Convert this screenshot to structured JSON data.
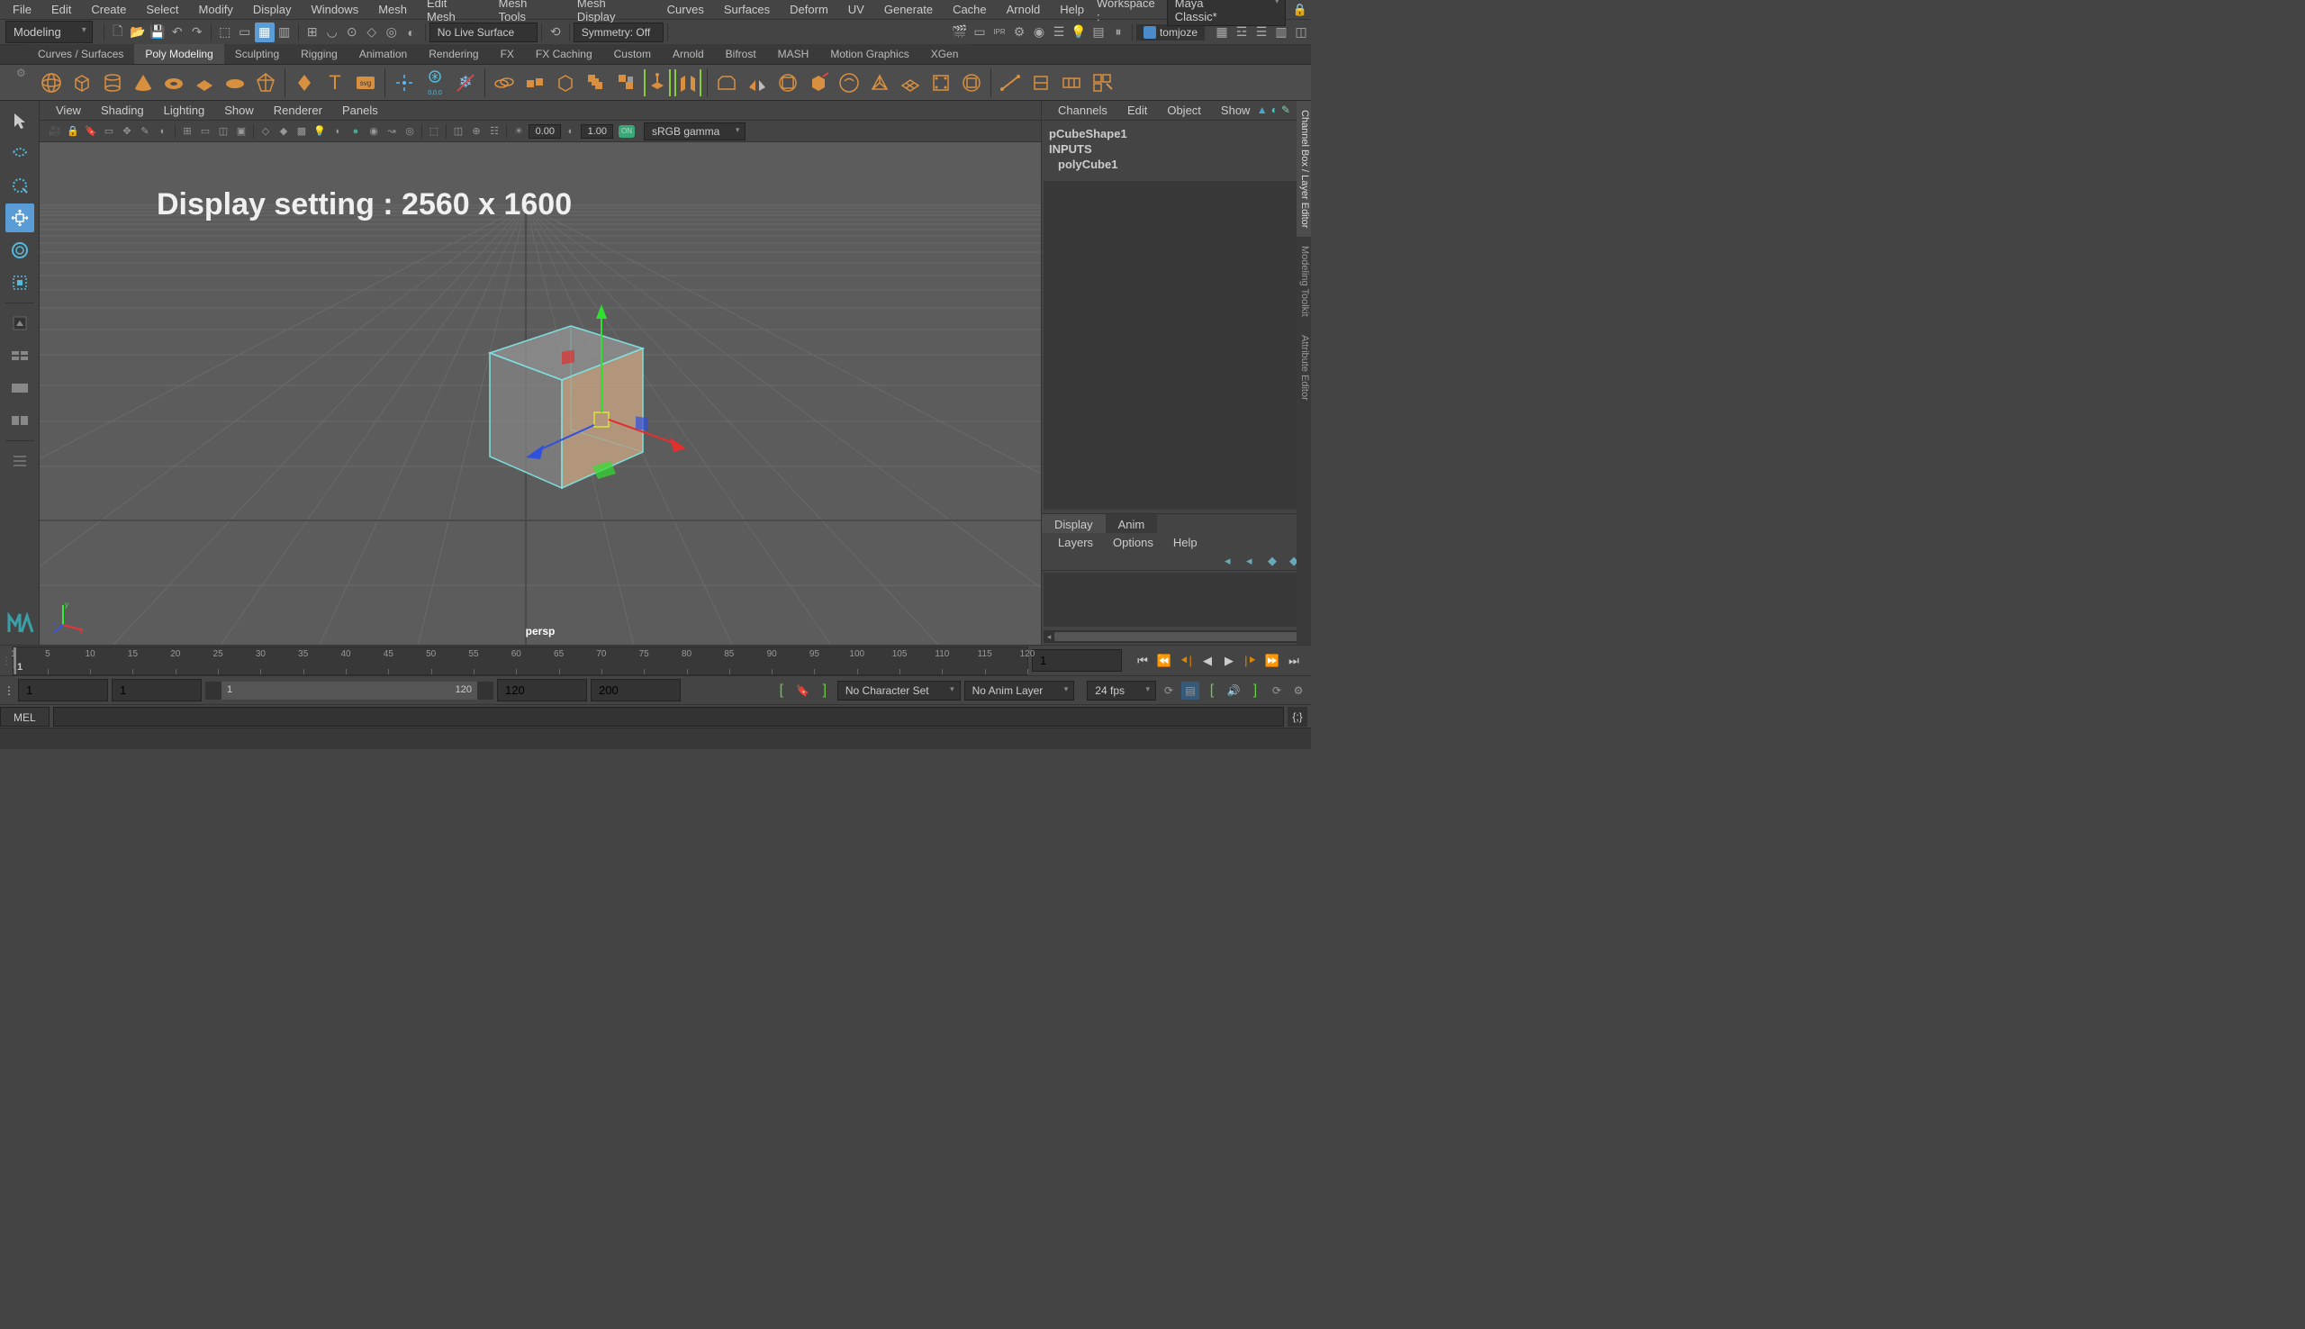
{
  "menubar": {
    "items": [
      "File",
      "Edit",
      "Create",
      "Select",
      "Modify",
      "Display",
      "Windows",
      "Mesh",
      "Edit Mesh",
      "Mesh Tools",
      "Mesh Display",
      "Curves",
      "Surfaces",
      "Deform",
      "UV",
      "Generate",
      "Cache",
      "Arnold",
      "Help"
    ],
    "workspace_label": "Workspace :",
    "workspace_value": "Maya Classic*"
  },
  "row2": {
    "mode": "Modeling",
    "live_surface": "No Live Surface",
    "symmetry": "Symmetry: Off",
    "user": "tomjoze"
  },
  "shelf_tabs": [
    "Curves / Surfaces",
    "Poly Modeling",
    "Sculpting",
    "Rigging",
    "Animation",
    "Rendering",
    "FX",
    "FX Caching",
    "Custom",
    "Arnold",
    "Bifrost",
    "MASH",
    "Motion Graphics",
    "XGen"
  ],
  "shelf_active_index": 1,
  "shelf_labels": {
    "svg_badge": "svg",
    "origin_badge": "0,0,0"
  },
  "viewport": {
    "menu": [
      "View",
      "Shading",
      "Lighting",
      "Show",
      "Renderer",
      "Panels"
    ],
    "exposure": "0.00",
    "gamma": "1.00",
    "color_mode": "sRGB gamma",
    "camera": "persp",
    "overlay": "Display setting : 2560 x 1600"
  },
  "channelbox": {
    "menu": [
      "Channels",
      "Edit",
      "Object",
      "Show"
    ],
    "nodes": [
      "pCubeShape1",
      "INPUTS",
      "polyCube1"
    ]
  },
  "layers": {
    "tabs": [
      "Display",
      "Anim"
    ],
    "menu": [
      "Layers",
      "Options",
      "Help"
    ]
  },
  "right_tabs": [
    "Channel Box / Layer Editor",
    "Modeling Toolkit",
    "Attribute Editor"
  ],
  "timeline": {
    "ticks": [
      1,
      5,
      10,
      15,
      20,
      25,
      30,
      35,
      40,
      45,
      50,
      55,
      60,
      65,
      70,
      75,
      80,
      85,
      90,
      95,
      100,
      105,
      110,
      115,
      120
    ],
    "current_frame": "1",
    "range": {
      "start": "1",
      "playback_start": "1",
      "playback_end": "120",
      "vis_start": "1",
      "vis_end": "120",
      "end": "200"
    },
    "charset": "No Character Set",
    "animlayer": "No Anim Layer",
    "fps": "24 fps"
  },
  "cmdline": {
    "lang": "MEL"
  }
}
